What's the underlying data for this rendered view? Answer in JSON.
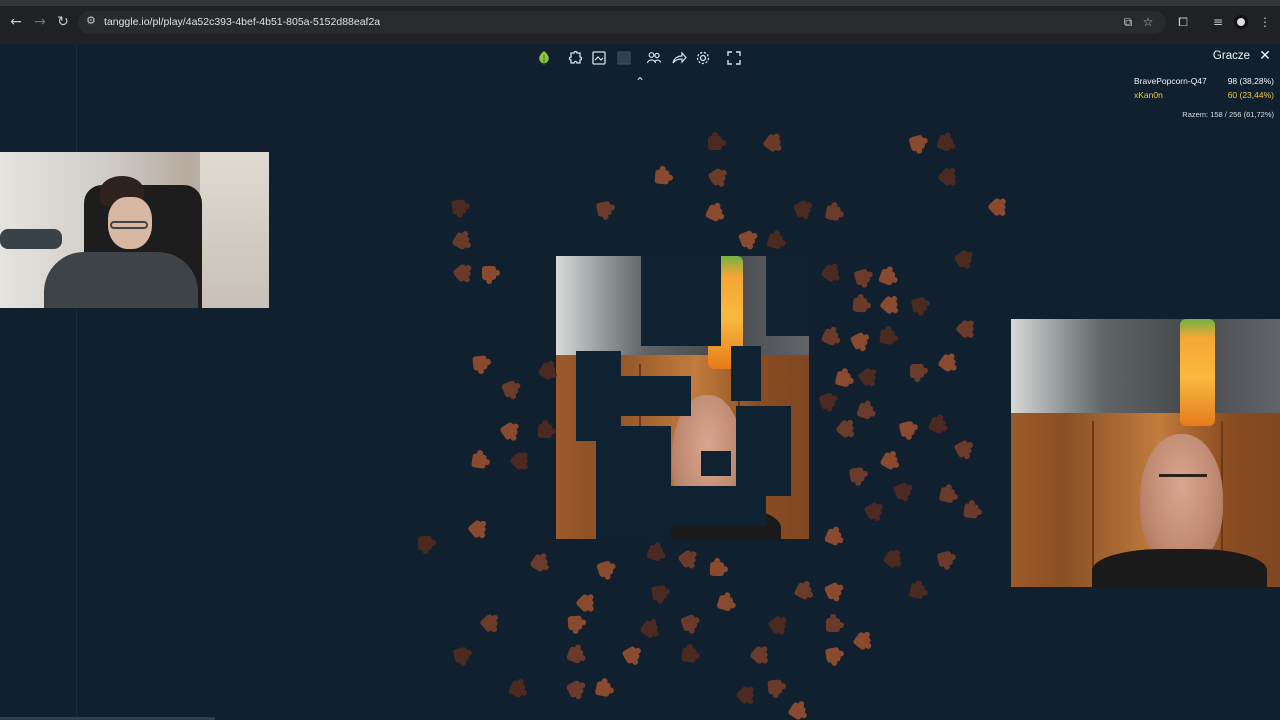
{
  "browser": {
    "url": "tanggle.io/pl/play/4a52c393-4bef-4b51-805a-5152d88eaf2a"
  },
  "toolbar": {
    "tools": [
      "tree-icon",
      "puzzle-icon",
      "image-icon",
      "square-icon",
      "players-icon",
      "share-icon",
      "settings-icon",
      "fullscreen-icon"
    ]
  },
  "players": {
    "title": "Gracze",
    "rows": [
      {
        "name": "BravePopcorn-Q47",
        "score": "98 (38,28%)",
        "color": "#f1f3f5"
      },
      {
        "name": "xKan0n",
        "score": "60 (23,44%)",
        "color": "#f4c54a"
      }
    ],
    "total": "Razem: 158 / 256 (61,72%)"
  },
  "colors": {
    "background": "#10202f",
    "piece_dark": "#4a2a21",
    "piece_mid": "#6a3b2a",
    "piece_light": "#8a4a2f"
  }
}
